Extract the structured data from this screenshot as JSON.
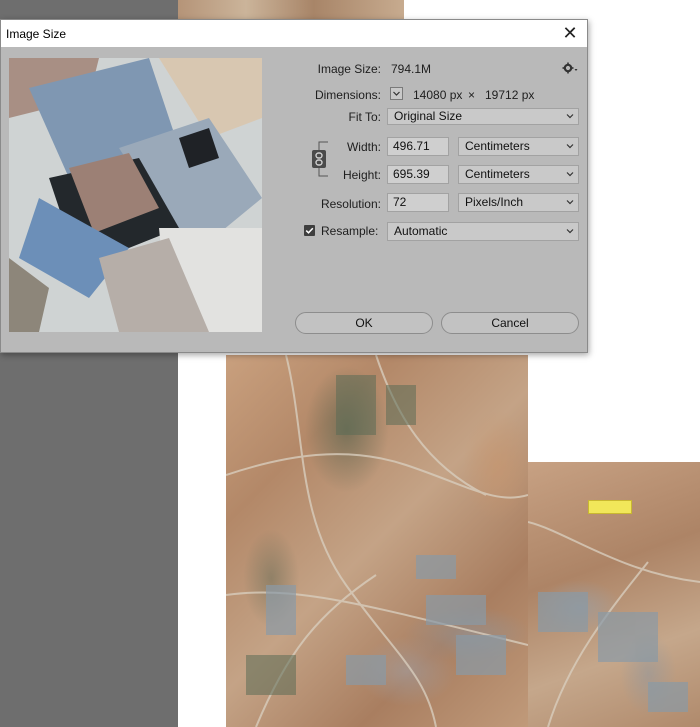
{
  "dialog": {
    "title": "Image Size",
    "close_glyph": "✕",
    "image_size_label": "Image Size:",
    "image_size_value": "794.1M",
    "dimensions_label": "Dimensions:",
    "dimensions_width": "14080 px",
    "dimensions_times": "×",
    "dimensions_height": "19712 px",
    "fit_to_label": "Fit To:",
    "fit_to_value": "Original Size",
    "width_label": "Width:",
    "width_value": "496.71",
    "width_unit": "Centimeters",
    "height_label": "Height:",
    "height_value": "695.39",
    "height_unit": "Centimeters",
    "resolution_label": "Resolution:",
    "resolution_value": "72",
    "resolution_unit": "Pixels/Inch",
    "resample_label": "Resample:",
    "resample_checked": true,
    "resample_value": "Automatic",
    "ok_label": "OK",
    "cancel_label": "Cancel"
  },
  "icons": {
    "settings": "gear-icon",
    "dimensions_toggle": "chevron-down-icon",
    "constrain_proportions": "link-icon",
    "dropdown": "chevron-down-icon",
    "close": "close-icon"
  },
  "colors": {
    "dialog_bg": "#b9b9b9",
    "workspace_bg": "#6e6e6e",
    "canvas_bg": "#ffffff"
  }
}
